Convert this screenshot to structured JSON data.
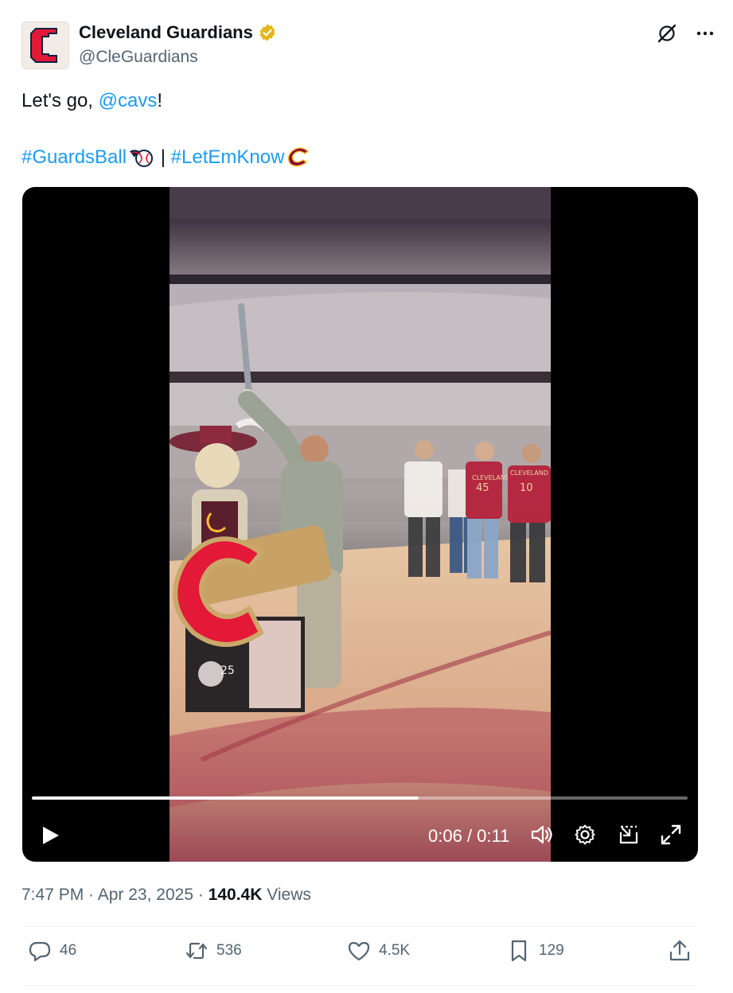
{
  "author": {
    "name": "Cleveland Guardians",
    "handle": "@CleGuardians",
    "avatar_letter": "C",
    "verified": true
  },
  "tweet": {
    "text_prefix": "Let's go, ",
    "mention": "@cavs",
    "text_suffix": "!",
    "hashtag1": "#GuardsBall",
    "separator": " | ",
    "hashtag2": "#LetEmKnow"
  },
  "video": {
    "time_label": "0:06 / 0:11",
    "progress": 0.59,
    "overlay_text": {
      "jersey1_name": "CLEVELAND",
      "jersey1_number": "45",
      "jersey2_name": "CLEVELAND",
      "jersey2_number": "10",
      "podium_badge": "25"
    }
  },
  "meta": {
    "time": "7:47 PM",
    "dot": " · ",
    "date": "Apr 23, 2025",
    "views_count": "140.4K",
    "views_label": " Views"
  },
  "actions": {
    "replies": "46",
    "reposts": "536",
    "likes": "4.5K",
    "bookmarks": "129"
  },
  "colors": {
    "link": "#1d9bf0",
    "secondary_text": "#536471",
    "guardians_red": "#e31937",
    "cavs_wine": "#860038",
    "cavs_gold": "#fdbb30"
  },
  "icons": [
    "grok-icon",
    "more-icon",
    "verified-badge-icon",
    "play-icon",
    "volume-icon",
    "settings-icon",
    "pip-icon",
    "fullscreen-icon",
    "reply-icon",
    "repost-icon",
    "like-icon",
    "bookmark-icon",
    "share-icon"
  ]
}
